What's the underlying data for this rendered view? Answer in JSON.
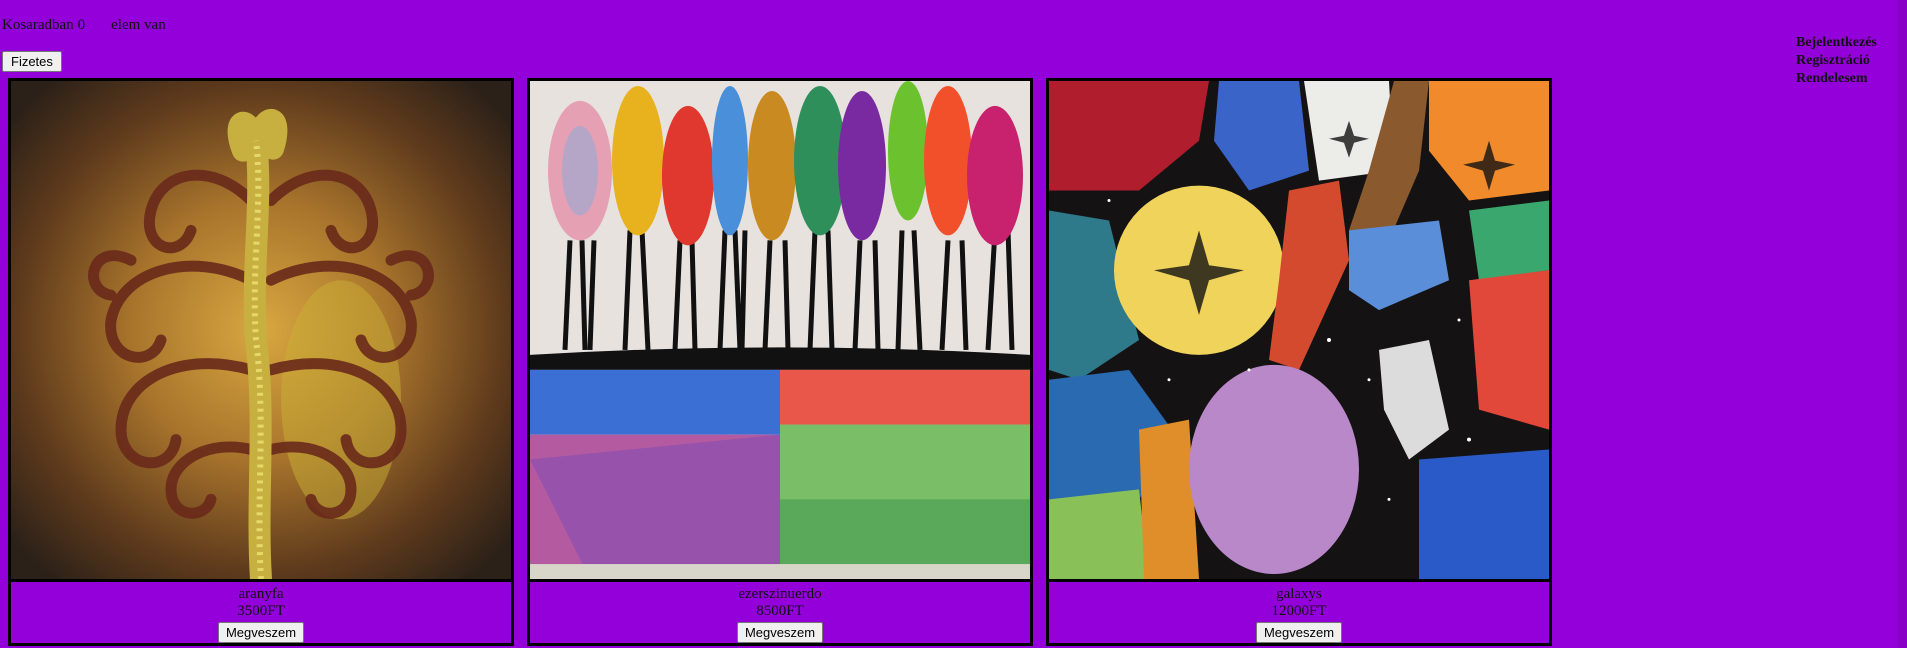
{
  "cart": {
    "prefix": "Kosaradban",
    "count": "0",
    "suffix": "elem van"
  },
  "checkout_label": "Fizetes",
  "nav": {
    "login": "Bejelentkezés",
    "register": "Regisztráció",
    "orders": "Rendelesem"
  },
  "products": [
    {
      "name": "aranyfa",
      "price": "3500FT",
      "buy_label": "Megveszem"
    },
    {
      "name": "ezerszinuerdo",
      "price": "8500FT",
      "buy_label": "Megveszem"
    },
    {
      "name": "galaxys",
      "price": "12000FT",
      "buy_label": "Megveszem"
    }
  ],
  "colors": {
    "background": "#9400d9"
  }
}
